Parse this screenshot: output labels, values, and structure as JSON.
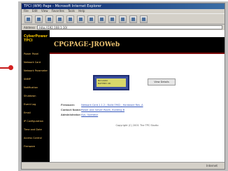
{
  "window": {
    "title": "TPCI (WM) Page - Microsoft Internet Explorer",
    "menu": [
      "File",
      "Edit",
      "View",
      "Favorites",
      "Tools",
      "Help"
    ],
    "address_label": "Address",
    "address": "http://192.168.1.10/"
  },
  "sidebar": {
    "logo_line1": "CyberPower",
    "logo_line2": "TPCI",
    "items": [
      "Power Panel",
      "Network Card",
      "Network Parameters",
      "SNMP",
      "Notification",
      "Shutdown",
      "Event Log",
      "Email",
      "IP Configuration",
      "Time and Date",
      "Access Control",
      "Firmware"
    ]
  },
  "header": {
    "title": "CPGPAGE-JROWeb"
  },
  "panel": {
    "lcd_line1": "NO LOAD",
    "lcd_line2": "BATTERY OK"
  },
  "view_button": "View Details",
  "info": [
    {
      "label": "Firmware:",
      "value": "Network Card 1.1.2 ; Build 0902 ; Hardware Rev. A"
    },
    {
      "label": "Contact Name:",
      "value": "Power and Server Room, Building B"
    },
    {
      "label": "Administrator:",
      "value": "Sys. Operator"
    }
  ],
  "copyright": "Copyright (C) 2001 The TPC Studio",
  "status": {
    "left": "",
    "right": "Internet"
  }
}
